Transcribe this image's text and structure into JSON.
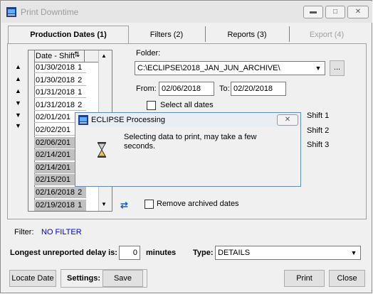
{
  "window": {
    "title": "Print Downtime"
  },
  "tabs": [
    {
      "label": "Production Dates (1)",
      "active": true
    },
    {
      "label": "Filters (2)",
      "active": false
    },
    {
      "label": "Reports (3)",
      "active": false
    },
    {
      "label": "Export (4)",
      "active": false,
      "disabled": true
    }
  ],
  "grid": {
    "header": "Date - Shift",
    "rows": [
      {
        "date": "01/30/2018",
        "shift": "1",
        "selected": false
      },
      {
        "date": "01/30/2018",
        "shift": "2",
        "selected": false
      },
      {
        "date": "01/31/2018",
        "shift": "1",
        "selected": false
      },
      {
        "date": "01/31/2018",
        "shift": "2",
        "selected": false
      },
      {
        "date": "02/01/201",
        "shift": "",
        "selected": false
      },
      {
        "date": "02/02/201",
        "shift": "",
        "selected": false
      },
      {
        "date": "02/06/201",
        "shift": "",
        "selected": true
      },
      {
        "date": "02/14/201",
        "shift": "",
        "selected": true
      },
      {
        "date": "02/14/201",
        "shift": "",
        "selected": true
      },
      {
        "date": "02/15/201",
        "shift": "",
        "selected": true
      },
      {
        "date": "02/16/2018",
        "shift": "2",
        "selected": true
      },
      {
        "date": "02/19/2018",
        "shift": "1",
        "selected": true
      }
    ]
  },
  "folder": {
    "label": "Folder:",
    "value": "C:\\ECLIPSE\\2018_JAN_JUN_ARCHIVE\\",
    "browse_label": "..."
  },
  "range": {
    "from_label": "From:",
    "from_value": "02/06/2018",
    "to_label": "To:",
    "to_value": "02/20/2018"
  },
  "select_all_label": "Select all dates",
  "shifts": [
    "Shift 1",
    "Shift 2",
    "Shift 3"
  ],
  "remove_archived_label": "Remove archived dates",
  "filter": {
    "label": "Filter:",
    "value": "NO FILTER",
    "value_color": "#0000cc"
  },
  "longest": {
    "label": "Longest unreported delay is:",
    "value": "0",
    "unit": "minutes"
  },
  "type": {
    "label": "Type:",
    "value": "DETAILS"
  },
  "footer": {
    "locate_label": "Locate Date",
    "settings_label": "Settings:",
    "save_label": "Save",
    "print_label": "Print",
    "close_label": "Close"
  },
  "dialog": {
    "title": "ECLIPSE Processing",
    "message": "Selecting data to print, may take a few seconds."
  }
}
